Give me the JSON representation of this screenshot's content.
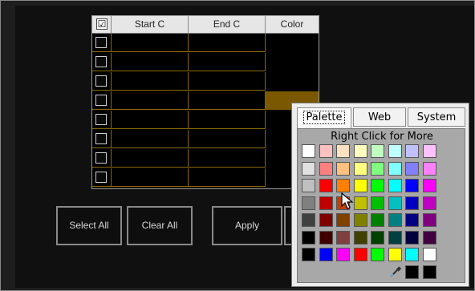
{
  "table": {
    "select_all_checked": "☑",
    "headers": [
      "Start C",
      "End C",
      "Color"
    ],
    "rows": [
      {
        "start": "",
        "end": "",
        "color": "#000000"
      },
      {
        "start": "",
        "end": "",
        "color": "#000000"
      },
      {
        "start": "",
        "end": "",
        "color": "#000000"
      },
      {
        "start": "",
        "end": "",
        "color": "#7a5800"
      },
      {
        "start": "",
        "end": "",
        "color": "#000000"
      },
      {
        "start": "",
        "end": "",
        "color": "#000000"
      },
      {
        "start": "",
        "end": "",
        "color": "#000000"
      },
      {
        "start": "",
        "end": "",
        "color": "#000000"
      }
    ]
  },
  "buttons": {
    "select_all": "Select All",
    "clear_all": "Clear All",
    "apply": "Apply"
  },
  "palette": {
    "tabs": [
      "Palette",
      "Web",
      "System"
    ],
    "active_tab": "Palette",
    "hint": "Right Click for More",
    "rows": [
      [
        "#ffffff",
        "#ffc0c0",
        "#ffe0c0",
        "#ffffc0",
        "#c0ffc0",
        "#c0ffff",
        "#c0c0ff",
        "#ffc0ff"
      ],
      [
        "#e0e0e0",
        "#ff8080",
        "#ffc080",
        "#ffff80",
        "#80ff80",
        "#80ffff",
        "#8080ff",
        "#ff80ff"
      ],
      [
        "#c0c0c0",
        "#ff0000",
        "#ff8000",
        "#ffff00",
        "#00ff00",
        "#00ffff",
        "#0000ff",
        "#ff00ff"
      ],
      [
        "#808080",
        "#c00000",
        "#c04000",
        "#c0c000",
        "#00c000",
        "#00c0c0",
        "#0000c0",
        "#c000c0"
      ],
      [
        "#404040",
        "#800000",
        "#804000",
        "#808000",
        "#008000",
        "#008080",
        "#000080",
        "#800080"
      ],
      [
        "#000000",
        "#400000",
        "#804040",
        "#404000",
        "#004000",
        "#004040",
        "#000040",
        "#400040"
      ],
      [
        "#000000",
        "#0000ff",
        "#ff00ff",
        "#ff0000",
        "#00ff00",
        "#ffff00",
        "#00ffff",
        "#ffffff"
      ]
    ],
    "extra_row": [
      "#000000",
      "#000000"
    ],
    "eyedropper_icon": "eyedropper-icon"
  }
}
